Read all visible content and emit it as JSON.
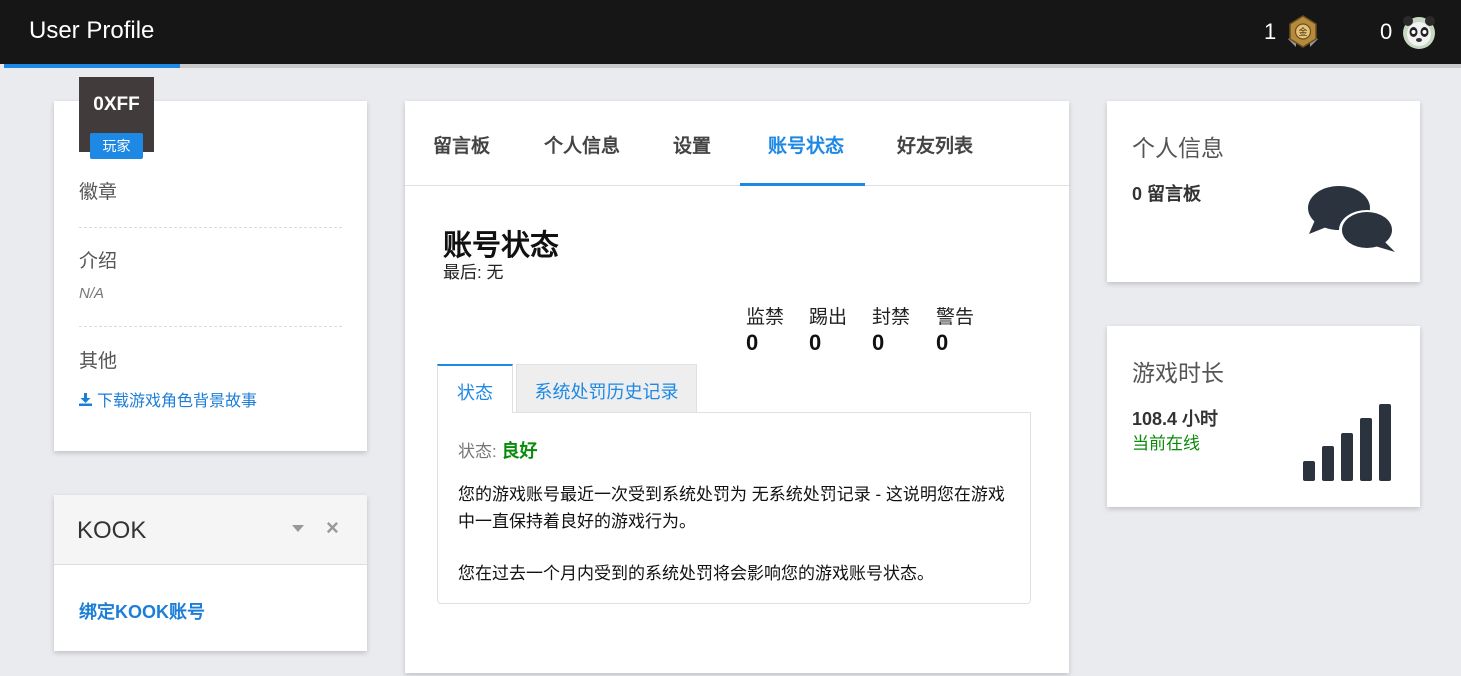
{
  "app": {
    "title": "User Profile"
  },
  "topbar": {
    "stat_1": {
      "count": "1",
      "icon": "medal-icon"
    },
    "stat_2": {
      "count": "0",
      "icon": "panda-avatar-icon"
    }
  },
  "profile": {
    "avatar_text": "0XFF",
    "role_badge": "玩家",
    "badges_label": "徽章",
    "intro_label": "介绍",
    "intro_value": "N/A",
    "other_label": "其他",
    "download_link": "下载游戏角色背景故事"
  },
  "kook": {
    "title": "KOOK",
    "bind_link": "绑定KOOK账号"
  },
  "tabs": [
    {
      "label": "留言板"
    },
    {
      "label": "个人信息"
    },
    {
      "label": "设置"
    },
    {
      "label": "账号状态",
      "active": true
    },
    {
      "label": "好友列表"
    }
  ],
  "account": {
    "title": "账号状态",
    "last_label": "最后: 无",
    "counters": [
      {
        "label": "监禁",
        "value": "0"
      },
      {
        "label": "踢出",
        "value": "0"
      },
      {
        "label": "封禁",
        "value": "0"
      },
      {
        "label": "警告",
        "value": "0"
      }
    ],
    "subtabs": [
      {
        "label": "状态",
        "active": true
      },
      {
        "label": "系统处罚历史记录"
      }
    ],
    "status_prefix": "状态:",
    "status_value": "良好",
    "paragraph_1": "您的游戏账号最近一次受到系统处罚为 无系统处罚记录 - 这说明您在游戏中一直保持着良好的游戏行为。",
    "paragraph_2": "您在过去一个月内受到的系统处罚将会影响您的游戏账号状态。"
  },
  "info_card": {
    "title": "个人信息",
    "value": "0 留言板",
    "icon": "comments-icon"
  },
  "playtime_card": {
    "title": "游戏时长",
    "value": "108.4 小时",
    "status": "当前在线",
    "icon": "signal-bars-icon"
  },
  "colors": {
    "accent": "#1e88e5",
    "topbar": "#161616",
    "good": "#0a8a0a",
    "link": "#1d7ed8"
  }
}
